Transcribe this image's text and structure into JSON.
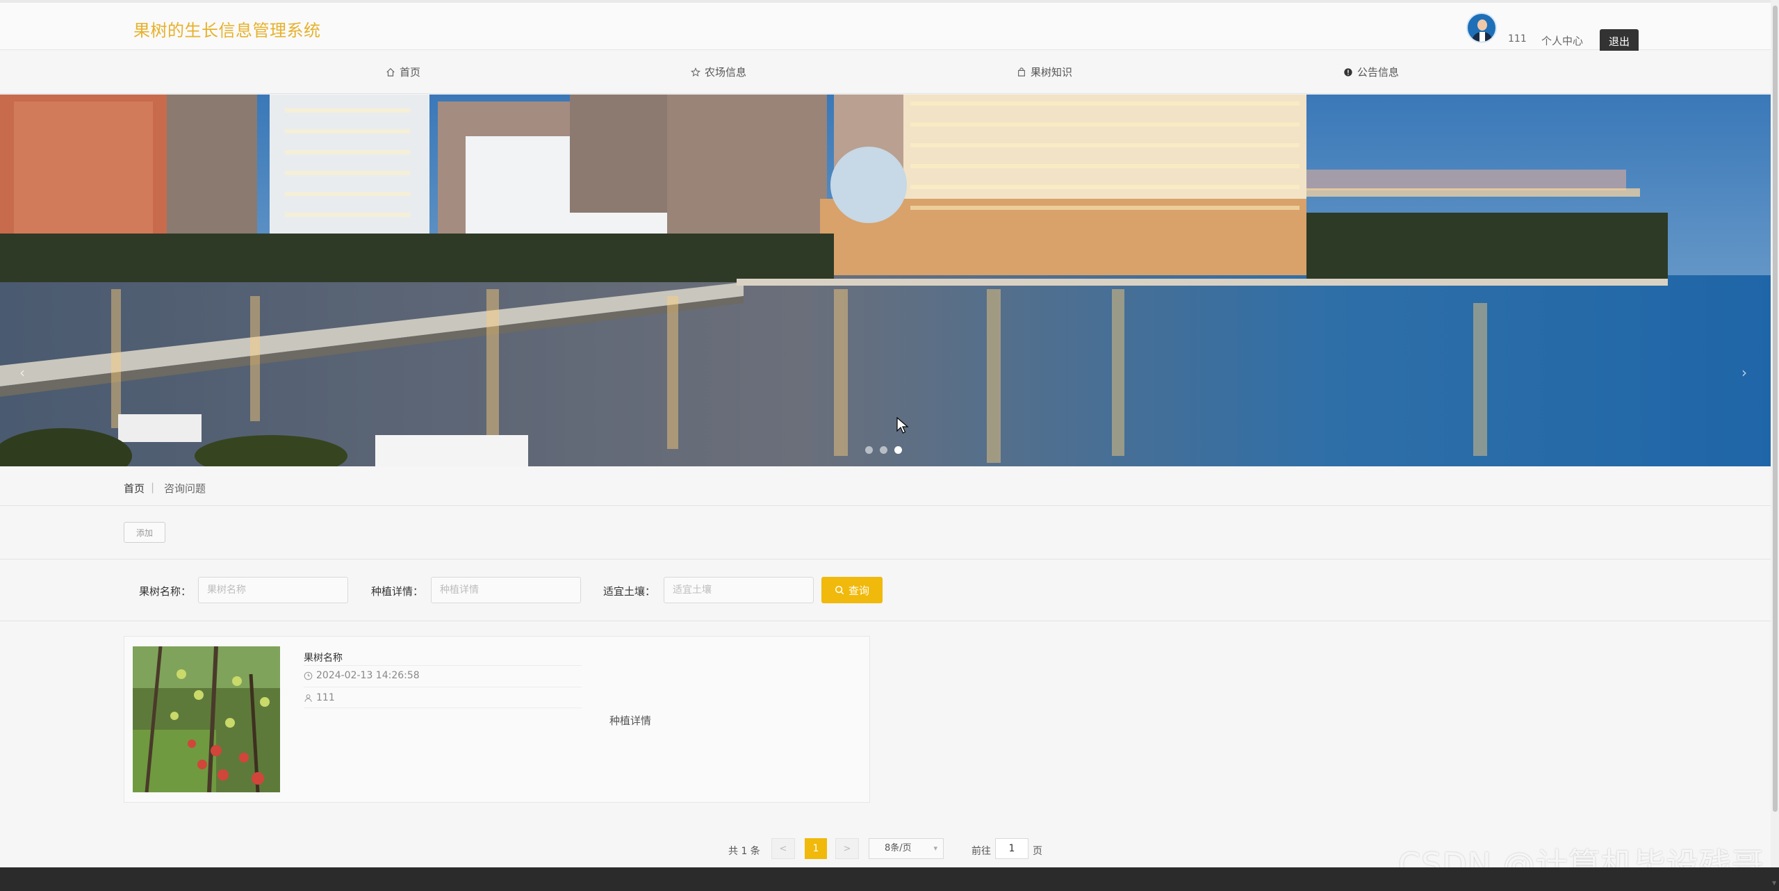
{
  "header": {
    "site_title": "果树的生长信息管理系统",
    "username": "111",
    "personal_center": "个人中心",
    "logout": "退出"
  },
  "nav": {
    "items": [
      {
        "label": "首页",
        "icon": "home-icon"
      },
      {
        "label": "农场信息",
        "icon": "star-icon"
      },
      {
        "label": "果树知识",
        "icon": "bag-icon"
      },
      {
        "label": "公告信息",
        "icon": "info-icon"
      }
    ]
  },
  "banner": {
    "prev_arrow": "‹",
    "next_arrow": "›",
    "slide_count": 3,
    "active_slide": 3
  },
  "breadcrumb": {
    "home": "首页",
    "separator": "|",
    "current": "咨询问题"
  },
  "actions": {
    "add_label": "添加"
  },
  "search": {
    "fields": [
      {
        "label": "果树名称：",
        "placeholder": "果树名称",
        "value": ""
      },
      {
        "label": "种植详情：",
        "placeholder": "种植详情",
        "value": ""
      },
      {
        "label": "适宜土壤：",
        "placeholder": "适宜土壤",
        "value": ""
      }
    ],
    "query_label": "查询"
  },
  "list": {
    "items": [
      {
        "title": "果树名称",
        "time": "2024-02-13 14:26:58",
        "user": "111",
        "detail": "种植详情"
      }
    ]
  },
  "pagination": {
    "total": "共 1 条",
    "prev": "<",
    "next": ">",
    "current_page": "1",
    "page_size": "8条/页",
    "goto_label": "前往",
    "goto_value": "1",
    "page_unit": "页"
  },
  "watermark": "CSDN @计算机毕设残哥",
  "colors": {
    "accent": "#f0b90b",
    "title": "#e7b12b",
    "logout_bg": "#333333"
  }
}
